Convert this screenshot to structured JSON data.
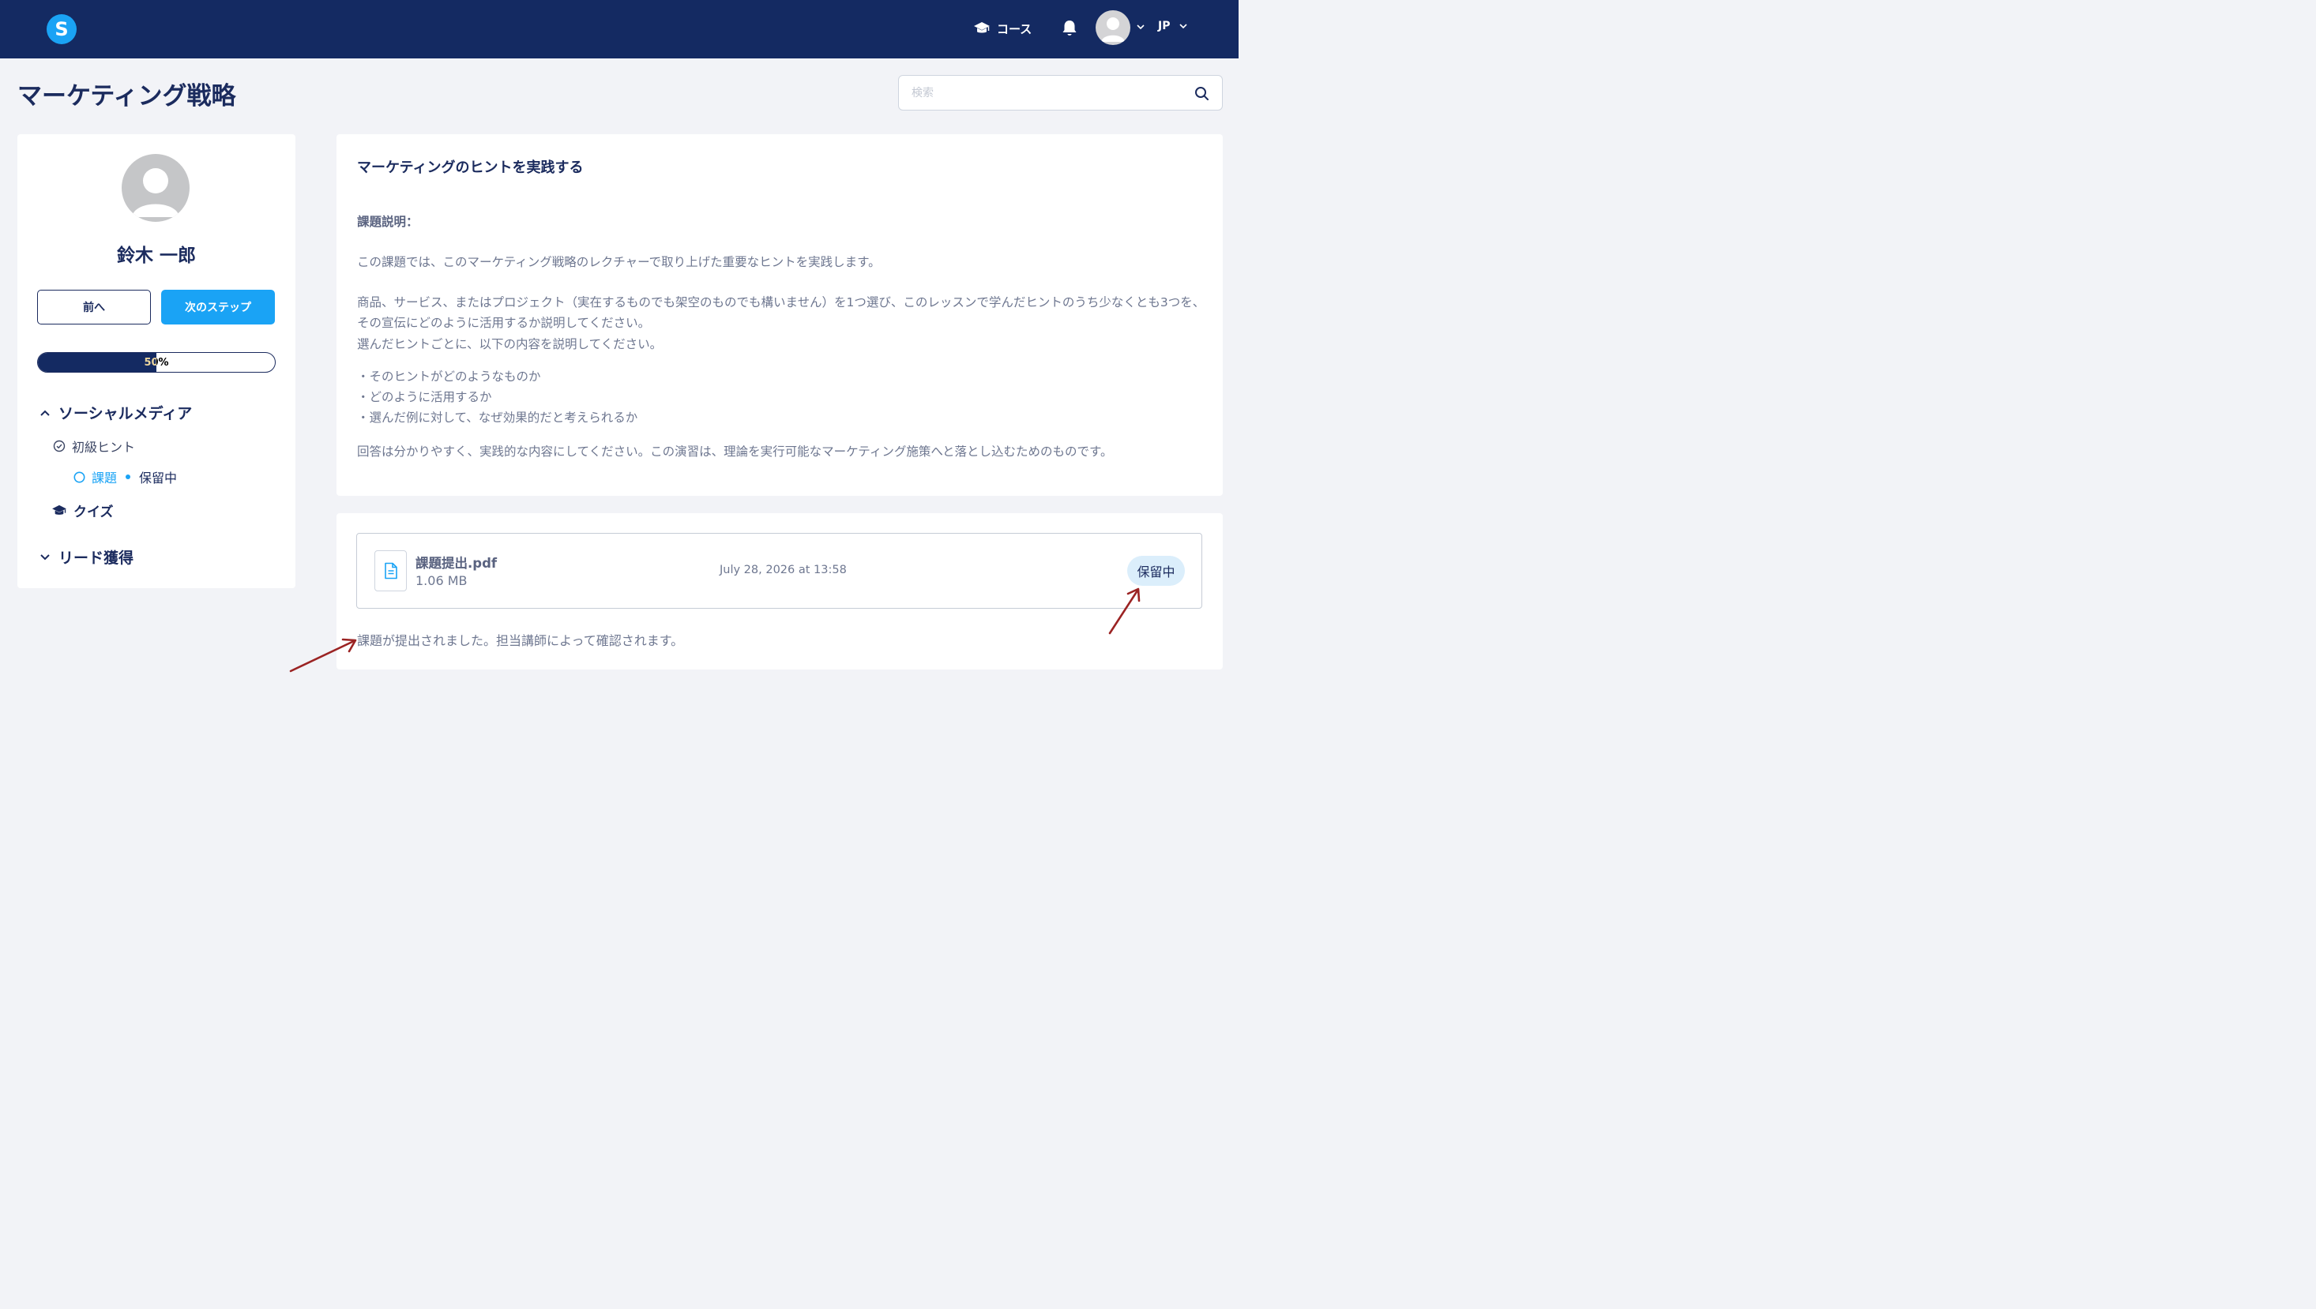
{
  "header": {
    "logo_letter": "S",
    "courses_label": "コース",
    "language": "JP"
  },
  "page": {
    "title": "マーケティング戦略"
  },
  "search": {
    "placeholder": "検索"
  },
  "sidebar": {
    "user_name": "鈴木 一郎",
    "prev_button": "前へ",
    "next_button": "次のステップ",
    "progress": {
      "value": 0.5,
      "label": "50%"
    },
    "sections": [
      {
        "title": "ソーシャルメディア",
        "expanded": true,
        "items": [
          {
            "label": "初級ヒント",
            "icon": "check-circle-icon"
          },
          {
            "label": "課題",
            "status": "保留中",
            "icon": "circle-icon"
          }
        ]
      },
      {
        "title": "クイズ",
        "icon": "graduation-cap-icon"
      },
      {
        "title": "リード獲得",
        "expanded": false
      }
    ]
  },
  "assignment": {
    "title": "マーケティングのヒントを実践する",
    "heading": "課題説明：",
    "paragraph1": "この課題では、このマーケティング戦略のレクチャーで取り上げた重要なヒントを実践します。",
    "paragraph2": "商品、サービス、またはプロジェクト（実在するものでも架空のものでも構いません）を1つ選び、このレッスンで学んだヒントのうち少なくとも3つを、その宣伝にどのように活用するか説明してください。",
    "paragraph3": "選んだヒントごとに、以下の内容を説明してください。",
    "bullets": [
      "・そのヒントがどのようなものか",
      "・どのように活用するか",
      "・選んだ例に対して、なぜ効果的だと考えられるか"
    ],
    "paragraph4": "回答は分かりやすく、実践的な内容にしてください。この演習は、理論を実行可能なマーケティング施策へと落とし込むためのものです。"
  },
  "submission": {
    "file_name": "課題提出.pdf",
    "file_size": "1.06 MB",
    "date": "July 28, 2026 at 13:58",
    "status": "保留中",
    "note": "課題が提出されました。担当講師によって確認されます。"
  },
  "colors": {
    "navy": "#142a62",
    "accent": "#1aa3f5",
    "annotation_arrow": "#9b2323"
  }
}
